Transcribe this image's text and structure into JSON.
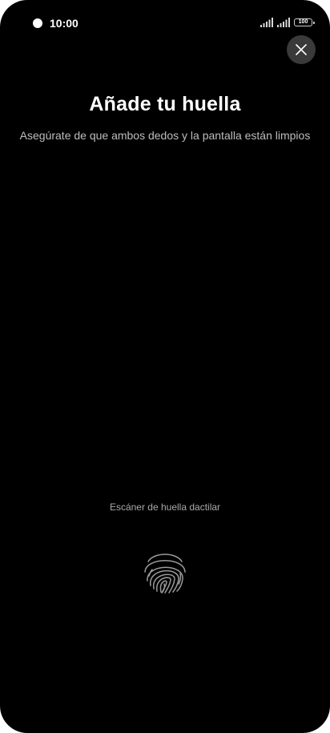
{
  "status_bar": {
    "time": "10:00",
    "battery": "100",
    "icons": [
      "camera-dot",
      "signal-bars-icon",
      "signal-bars-icon",
      "battery-icon"
    ]
  },
  "close_button": {
    "icon": "close-icon"
  },
  "main": {
    "title": "Añade tu huella",
    "subtitle": "Asegúrate de que ambos dedos y la pantalla están limpios",
    "scanner_label": "Escáner de huella dactilar",
    "scanner_icon": "fingerprint-icon"
  },
  "colors": {
    "background": "#000000",
    "title": "#ffffff",
    "subtitle": "#bdbdbd",
    "close_button_bg": "#3a3a3a"
  }
}
